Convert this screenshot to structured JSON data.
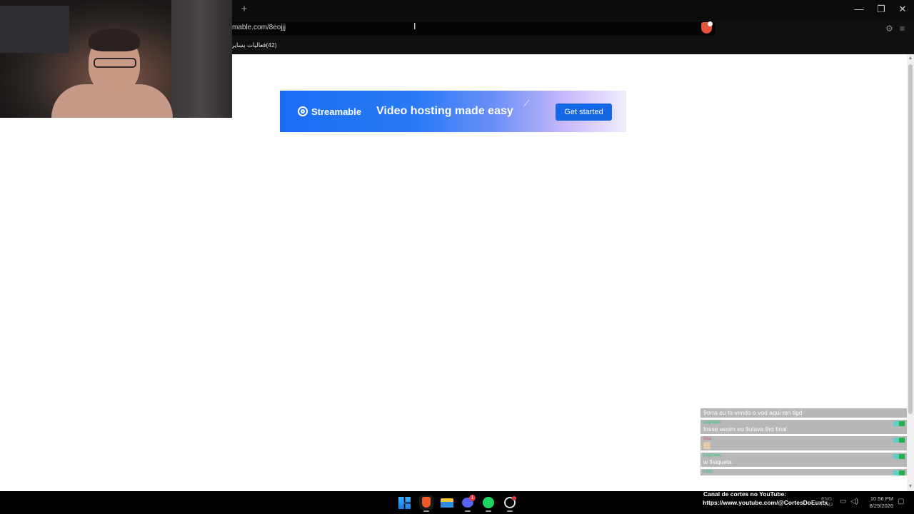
{
  "browser": {
    "new_tab": "+",
    "window_controls": {
      "minimize": "—",
      "restore": "❐",
      "close": "✕"
    },
    "url": "mable.com/8eojjj",
    "bookmark": "(42)فعاليات بساير"
  },
  "banner": {
    "brand": "Streamable",
    "tagline": "Video hosting made easy",
    "cta": "Get started"
  },
  "chat": {
    "messages": [
      {
        "user": "",
        "text": "9orra eu to vendo o vod aqui mn tlgd"
      },
      {
        "user": "pagnaldo",
        "text": "fosse assim eu 9ulava 9ro final"
      },
      {
        "user": "nisu",
        "text": ""
      },
      {
        "user": "pagnaldo",
        "text": "w fisiquela"
      },
      {
        "user": "lofeh",
        "text": ""
      }
    ]
  },
  "stream_overlay": {
    "line1": "Canal de cortes no YouTube:",
    "line2": "https://www.youtube.com/@CortesDoEuxtx"
  },
  "taskbar": {
    "apps": [
      "windows-start",
      "brave",
      "file-explorer",
      "discord",
      "spotify",
      "obs"
    ],
    "discord_badge": "1",
    "lang_1": "ENG",
    "lang_2": "PTB2",
    "time": "10:56 PM",
    "date": "8/29/2026"
  },
  "colors": {
    "banner_blue": "#1a6df3",
    "cta_blue": "#1667e6",
    "chat_bg": "#b7b7b7",
    "chat_username": "#2fc77a",
    "brave_orange": "#e2553a"
  }
}
